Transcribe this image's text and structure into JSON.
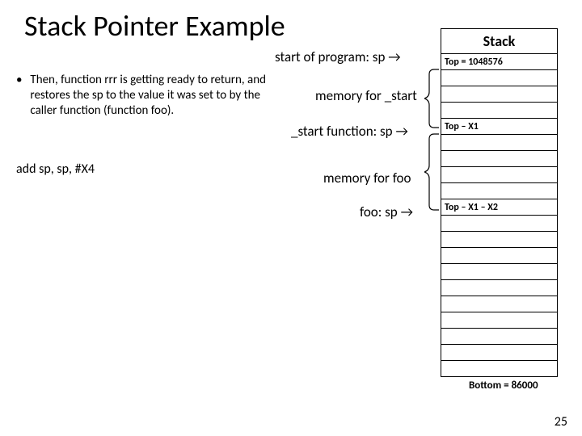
{
  "title": "Stack Pointer Example",
  "labels": {
    "start_prog": "start of program: sp →",
    "mem_start": "memory for _start",
    "start_func": "_start function:  sp →",
    "mem_foo": "memory for foo",
    "foo_sp": "foo:  sp →"
  },
  "bullet": {
    "dot": "•",
    "text": "Then, function rrr is getting ready to return, and restores the sp to the value it was set to by the caller function (function foo)."
  },
  "asm": "add sp, sp, #X4",
  "stack": {
    "header": "Stack",
    "rows": [
      "Top = 1048576",
      "",
      "",
      "",
      "Top – X1",
      "",
      "",
      "",
      "",
      "Top – X1 – X2",
      "",
      "",
      "",
      "",
      "",
      "",
      "",
      "",
      "",
      ""
    ],
    "bottom": "Bottom = 86000"
  },
  "slide_num": "25"
}
